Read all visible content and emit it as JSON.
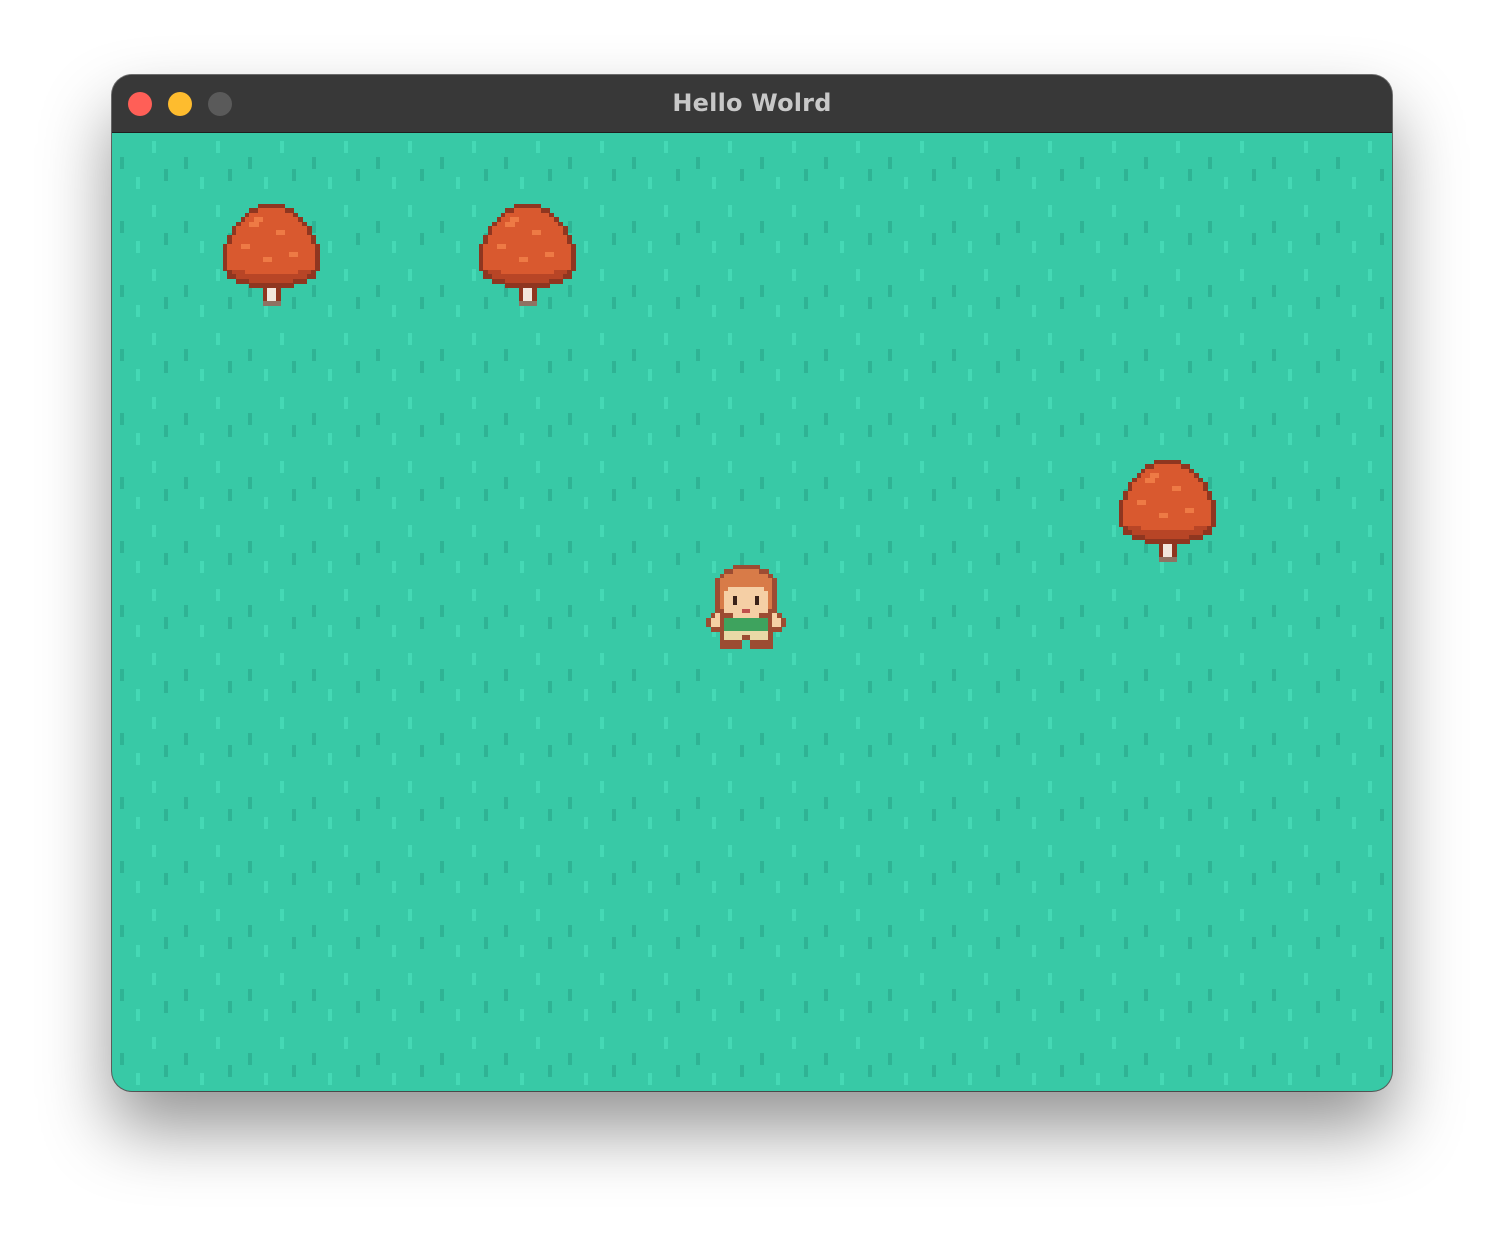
{
  "window": {
    "title": "Hello Wolrd",
    "controls": [
      {
        "name": "close",
        "color": "#ff5f57"
      },
      {
        "name": "minimize",
        "color": "#febc2e"
      },
      {
        "name": "zoom",
        "color": "#5a5a5a"
      }
    ]
  },
  "game": {
    "ground": {
      "type": "grass",
      "color": "#38c9a6",
      "blade_light": "#45d9b5",
      "blade_dark": "#2fb394"
    },
    "tree_colors": {
      "outline": "#8f3620",
      "leaf": "#d9592f",
      "leaf_light": "#ee7a45",
      "leaf_dark": "#b84526",
      "trunk": "#f2e6dc",
      "trunk_outline": "#8f7262"
    },
    "player_colors": {
      "outline": "#9c4c32",
      "hair": "#d87b48",
      "skin": "#f5cfa5",
      "shirt": "#3ea35e",
      "pants": "#e9d9a6",
      "boots": "#9c4c32"
    },
    "entities": [
      {
        "kind": "tree",
        "name": "tree-partial-top"
      },
      {
        "kind": "tree",
        "name": "tree-left"
      },
      {
        "kind": "tree",
        "name": "tree-center"
      },
      {
        "kind": "tree",
        "name": "tree-right"
      },
      {
        "kind": "player",
        "name": "player-character"
      }
    ]
  }
}
